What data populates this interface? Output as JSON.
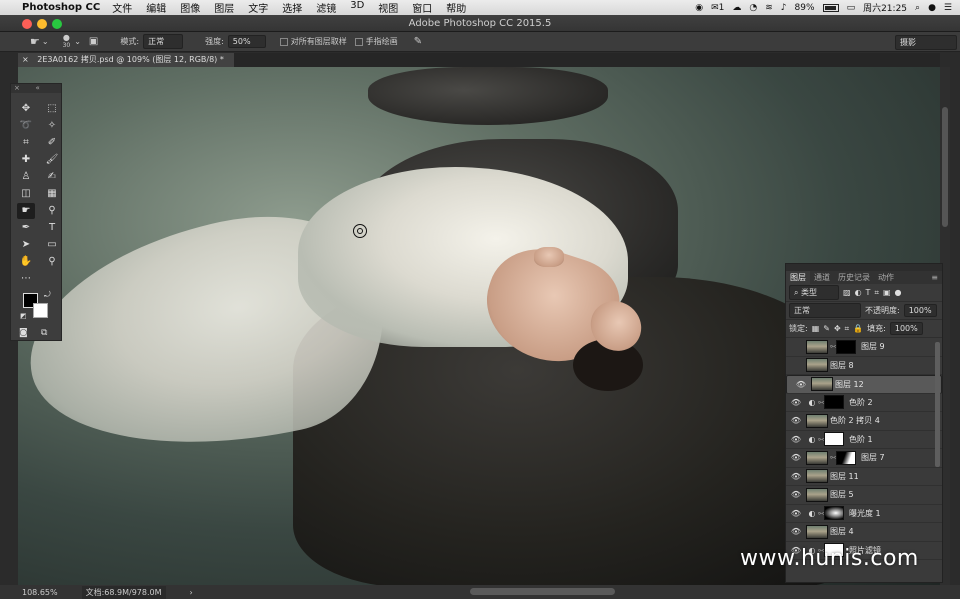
{
  "menubar": {
    "app_name": "Photoshop CC",
    "menus": [
      "文件",
      "编辑",
      "图像",
      "图层",
      "文字",
      "选择",
      "滤镜",
      "3D",
      "视图",
      "窗口",
      "帮助"
    ],
    "wechat_badge": "1",
    "battery": "89%",
    "clock": "周六21:25"
  },
  "window": {
    "title": "Adobe Photoshop CC 2015.5"
  },
  "options": {
    "brush_size": "30",
    "mode_label": "模式:",
    "mode_value": "正常",
    "strength_label": "强度:",
    "strength_value": "50%",
    "sample_all_label": "对所有图层取样",
    "finger_paint_label": "手指绘画",
    "workspace": "摄影"
  },
  "document": {
    "tab_title": "2E3A0162 拷贝.psd @ 109% (图层 12, RGB/8) *"
  },
  "status": {
    "zoom": "108.65%",
    "doc_size": "文档:68.9M/978.0M"
  },
  "layers_panel": {
    "tabs": [
      "图层",
      "通道",
      "历史记录",
      "动作"
    ],
    "filter_kind": "类型",
    "blend_mode": "正常",
    "opacity_label": "不透明度:",
    "opacity_value": "100%",
    "lock_label": "锁定:",
    "fill_label": "填充:",
    "fill_value": "100%",
    "layers": [
      {
        "name": "图层 9",
        "visible": false
      },
      {
        "name": "图层 8",
        "visible": false
      },
      {
        "name": "图层 12",
        "visible": true
      },
      {
        "name": "色阶 2",
        "visible": true
      },
      {
        "name": "色阶 2 拷贝 4",
        "visible": true
      },
      {
        "name": "色阶 1",
        "visible": true
      },
      {
        "name": "图层 7",
        "visible": true
      },
      {
        "name": "图层 11",
        "visible": true
      },
      {
        "name": "图层 5",
        "visible": true
      },
      {
        "name": "曝光度 1",
        "visible": true
      },
      {
        "name": "图层 4",
        "visible": true
      },
      {
        "name": "照片滤镜",
        "visible": true
      }
    ]
  },
  "watermark": "www.hunis.com"
}
